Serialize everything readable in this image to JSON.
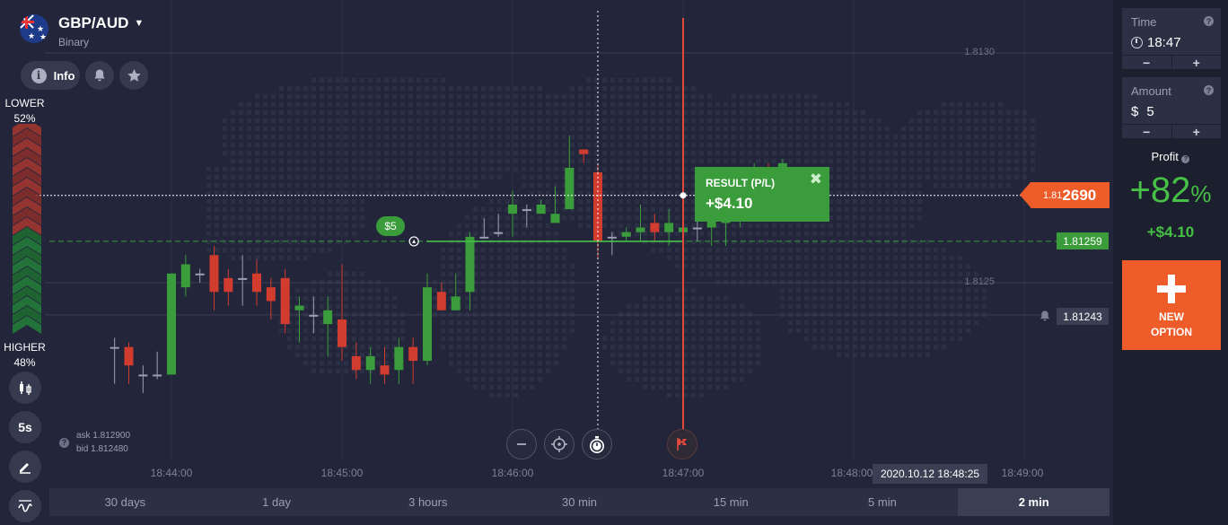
{
  "asset": {
    "name": "GBP/AUD",
    "type": "Binary"
  },
  "toolbar": {
    "info_label": "Info"
  },
  "sentiment": {
    "lower_label": "LOWER",
    "lower_pct": "52%",
    "higher_label": "HIGHER",
    "higher_pct": "48%"
  },
  "side_tools": {
    "interval_label": "5s"
  },
  "quote": {
    "ask": "ask 1.812900",
    "bid": "bid 1.812480"
  },
  "price_levels": [
    "1.8130",
    "1.8125"
  ],
  "current_price": {
    "prefix": "1.81",
    "suffix": "2690"
  },
  "strike_price": "1.81259",
  "alert_price": "1.81243",
  "result": {
    "label": "RESULT (P/L)",
    "value": "+$4.10"
  },
  "bet_bubble": "$5",
  "time_ticks": [
    "18:44:00",
    "18:45:00",
    "18:46:00",
    "18:47:00",
    "18:48:00",
    "18:49:00"
  ],
  "date_label": "2020.10.12 18:48:25",
  "timeframes": [
    {
      "label": "30 days",
      "active": false
    },
    {
      "label": "1 day",
      "active": false
    },
    {
      "label": "3 hours",
      "active": false
    },
    {
      "label": "30 min",
      "active": false
    },
    {
      "label": "15 min",
      "active": false
    },
    {
      "label": "5 min",
      "active": false
    },
    {
      "label": "2 min",
      "active": true
    }
  ],
  "panel": {
    "time_label": "Time",
    "time_value": "18:47",
    "amount_label": "Amount",
    "amount_currency": "$",
    "amount_value": "5",
    "minus": "−",
    "plus": "+",
    "profit_label": "Profit",
    "profit_pct": "+82",
    "profit_pct_sign": "%",
    "profit_amount": "+$4.10",
    "new_option_line1": "NEW",
    "new_option_line2": "OPTION"
  },
  "colors": {
    "up": "#3a9c3a",
    "down": "#d23c2e",
    "accent": "#ee5c2a",
    "flat": "#9aa0b2"
  },
  "chart_data": {
    "type": "candlestick",
    "y_range": [
      1.8121,
      1.8131
    ],
    "levels": [
      1.813,
      1.8125
    ],
    "strike": 1.81259,
    "current": 1.81269,
    "alert": 1.81243,
    "candles": [
      {
        "t": "18:43:40",
        "o": 1.81236,
        "h": 1.81238,
        "l": 1.81228,
        "c": 1.81236
      },
      {
        "t": "18:43:45",
        "o": 1.81236,
        "h": 1.81237,
        "l": 1.81228,
        "c": 1.81232
      },
      {
        "t": "18:43:50",
        "o": 1.8123,
        "h": 1.81232,
        "l": 1.81226,
        "c": 1.8123
      },
      {
        "t": "18:43:55",
        "o": 1.8123,
        "h": 1.81235,
        "l": 1.81229,
        "c": 1.8123
      },
      {
        "t": "18:44:00",
        "o": 1.8123,
        "h": 1.81252,
        "l": 1.8123,
        "c": 1.81252
      },
      {
        "t": "18:44:05",
        "o": 1.81249,
        "h": 1.81256,
        "l": 1.81247,
        "c": 1.81254
      },
      {
        "t": "18:44:10",
        "o": 1.81252,
        "h": 1.81253,
        "l": 1.8125,
        "c": 1.81252
      },
      {
        "t": "18:44:15",
        "o": 1.81256,
        "h": 1.81258,
        "l": 1.81244,
        "c": 1.81248
      },
      {
        "t": "18:44:20",
        "o": 1.81251,
        "h": 1.81253,
        "l": 1.81245,
        "c": 1.81248
      },
      {
        "t": "18:44:25",
        "o": 1.81251,
        "h": 1.81256,
        "l": 1.81245,
        "c": 1.81251
      },
      {
        "t": "18:44:30",
        "o": 1.81252,
        "h": 1.81255,
        "l": 1.81245,
        "c": 1.81248
      },
      {
        "t": "18:44:35",
        "o": 1.81249,
        "h": 1.81251,
        "l": 1.81242,
        "c": 1.81246
      },
      {
        "t": "18:44:40",
        "o": 1.81251,
        "h": 1.81253,
        "l": 1.81239,
        "c": 1.81241
      },
      {
        "t": "18:44:45",
        "o": 1.81244,
        "h": 1.81247,
        "l": 1.81237,
        "c": 1.81245
      },
      {
        "t": "18:44:50",
        "o": 1.81243,
        "h": 1.81247,
        "l": 1.81239,
        "c": 1.81243
      },
      {
        "t": "18:44:55",
        "o": 1.81241,
        "h": 1.81247,
        "l": 1.81234,
        "c": 1.81244
      },
      {
        "t": "18:45:00",
        "o": 1.81242,
        "h": 1.81254,
        "l": 1.81233,
        "c": 1.81236
      },
      {
        "t": "18:45:05",
        "o": 1.81234,
        "h": 1.81237,
        "l": 1.81229,
        "c": 1.81231
      },
      {
        "t": "18:45:10",
        "o": 1.81231,
        "h": 1.81236,
        "l": 1.81228,
        "c": 1.81234
      },
      {
        "t": "18:45:15",
        "o": 1.81232,
        "h": 1.81236,
        "l": 1.81228,
        "c": 1.8123
      },
      {
        "t": "18:45:20",
        "o": 1.81231,
        "h": 1.81238,
        "l": 1.81228,
        "c": 1.81236
      },
      {
        "t": "18:45:25",
        "o": 1.81236,
        "h": 1.81238,
        "l": 1.81228,
        "c": 1.81233
      },
      {
        "t": "18:45:30",
        "o": 1.81233,
        "h": 1.81252,
        "l": 1.81232,
        "c": 1.81249
      },
      {
        "t": "18:45:35",
        "o": 1.81248,
        "h": 1.8125,
        "l": 1.81244,
        "c": 1.81244
      },
      {
        "t": "18:45:40",
        "o": 1.81244,
        "h": 1.81252,
        "l": 1.81244,
        "c": 1.81247
      },
      {
        "t": "18:45:45",
        "o": 1.81248,
        "h": 1.81261,
        "l": 1.81244,
        "c": 1.8126
      },
      {
        "t": "18:45:50",
        "o": 1.8126,
        "h": 1.81264,
        "l": 1.8126,
        "c": 1.8126
      },
      {
        "t": "18:45:55",
        "o": 1.81261,
        "h": 1.81265,
        "l": 1.8126,
        "c": 1.81261
      },
      {
        "t": "18:46:00",
        "o": 1.81265,
        "h": 1.8127,
        "l": 1.8126,
        "c": 1.81267
      },
      {
        "t": "18:46:05",
        "o": 1.81266,
        "h": 1.81267,
        "l": 1.81262,
        "c": 1.81266
      },
      {
        "t": "18:46:10",
        "o": 1.81265,
        "h": 1.81268,
        "l": 1.81266,
        "c": 1.81267
      },
      {
        "t": "18:46:15",
        "o": 1.81263,
        "h": 1.81271,
        "l": 1.81264,
        "c": 1.81265
      },
      {
        "t": "18:46:20",
        "o": 1.81266,
        "h": 1.81282,
        "l": 1.81266,
        "c": 1.81275
      },
      {
        "t": "18:46:25",
        "o": 1.81279,
        "h": 1.81279,
        "l": 1.81276,
        "c": 1.81278
      },
      {
        "t": "18:46:30",
        "o": 1.81274,
        "h": 1.81276,
        "l": 1.81255,
        "c": 1.81259
      },
      {
        "t": "18:46:35",
        "o": 1.8126,
        "h": 1.81261,
        "l": 1.81256,
        "c": 1.8126
      },
      {
        "t": "18:46:40",
        "o": 1.8126,
        "h": 1.81262,
        "l": 1.81259,
        "c": 1.81261
      },
      {
        "t": "18:46:45",
        "o": 1.81261,
        "h": 1.81267,
        "l": 1.81259,
        "c": 1.81262
      },
      {
        "t": "18:46:50",
        "o": 1.81263,
        "h": 1.81265,
        "l": 1.81259,
        "c": 1.81261
      },
      {
        "t": "18:46:55",
        "o": 1.81261,
        "h": 1.81266,
        "l": 1.81258,
        "c": 1.81263
      },
      {
        "t": "18:47:00",
        "o": 1.81261,
        "h": 1.81266,
        "l": 1.81257,
        "c": 1.81262
      },
      {
        "t": "18:47:05",
        "o": 1.81262,
        "h": 1.81265,
        "l": 1.81259,
        "c": 1.81262
      },
      {
        "t": "18:47:10",
        "o": 1.81262,
        "h": 1.81266,
        "l": 1.81258,
        "c": 1.81264
      },
      {
        "t": "18:47:15",
        "o": 1.81263,
        "h": 1.81267,
        "l": 1.81258,
        "c": 1.81265
      },
      {
        "t": "18:47:20",
        "o": 1.81264,
        "h": 1.81272,
        "l": 1.81262,
        "c": 1.81269
      },
      {
        "t": "18:47:25",
        "o": 1.81269,
        "h": 1.81276,
        "l": 1.81265,
        "c": 1.81274
      },
      {
        "t": "18:47:30",
        "o": 1.81274,
        "h": 1.81276,
        "l": 1.81265,
        "c": 1.8127
      },
      {
        "t": "18:47:35",
        "o": 1.81269,
        "h": 1.81277,
        "l": 1.81268,
        "c": 1.81276
      }
    ]
  }
}
